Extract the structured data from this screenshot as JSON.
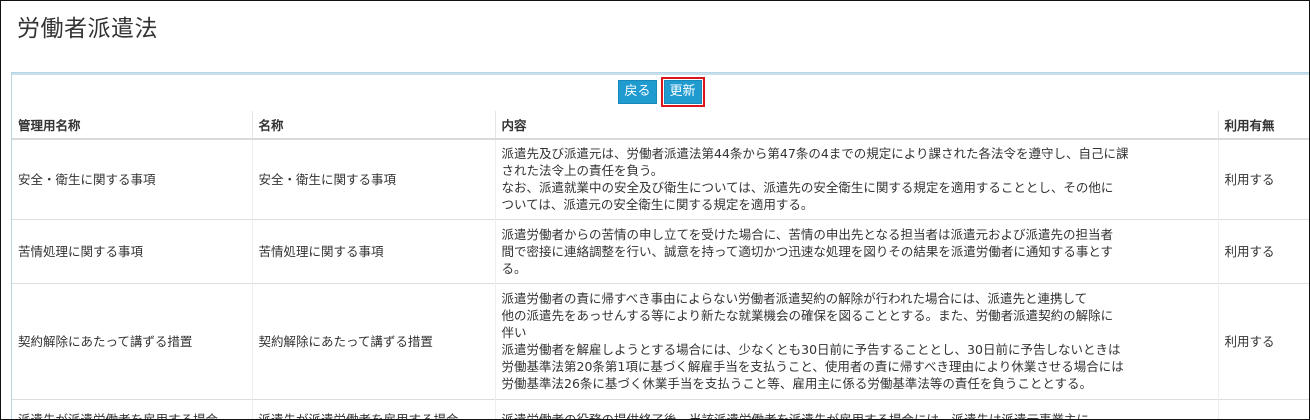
{
  "page": {
    "title": "労働者派遣法"
  },
  "toolbar": {
    "back_label": "戻る",
    "update_label": "更新"
  },
  "table": {
    "headers": {
      "admin_name": "管理用名称",
      "name": "名称",
      "content": "内容",
      "usage": "利用有無"
    },
    "rows": [
      {
        "admin_name": "安全・衛生に関する事項",
        "name": "安全・衛生に関する事項",
        "content_lines": [
          "派遣先及び派遣元は、労働者派遣法第44条から第47条の4までの規定により課された各法令を遵守し、自己に課",
          "された法令上の責任を負う。",
          "なお、派遣就業中の安全及び衛生については、派遣先の安全衛生に関する規定を適用することとし、その他に",
          "ついては、派遣元の安全衛生に関する規定を適用する。"
        ],
        "usage": "利用する"
      },
      {
        "admin_name": "苦情処理に関する事項",
        "name": "苦情処理に関する事項",
        "content_lines": [
          "派遣労働者からの苦情の申し立てを受けた場合に、苦情の申出先となる担当者は派遣元および派遣先の担当者",
          "間で密接に連絡調整を行い、誠意を持って適切かつ迅速な処理を図りその結果を派遣労働者に通知する事とす",
          "る。"
        ],
        "usage": "利用する"
      },
      {
        "admin_name": "契約解除にあたって講ずる措置",
        "name": "契約解除にあたって講ずる措置",
        "content_lines": [
          "派遣労働者の責に帰すべき事由によらない労働者派遣契約の解除が行われた場合には、派遣先と連携して",
          "他の派遣先をあっせんする等により新たな就業機会の確保を図ることとする。また、労働者派遣契約の解除に",
          "伴い",
          "派遣労働者を解雇しようとする場合には、少なくとも30日前に予告することとし、30日前に予告しないときは",
          "労働基準法第20条第1項に基づく解雇手当を支払うこと、使用者の責に帰すべき理由により休業させる場合には",
          "労働基準法26条に基づく休業手当を支払うこと等、雇用主に係る労働基準法等の責任を負うこととする。"
        ],
        "usage": "利用する"
      },
      {
        "admin_name": "派遣先が派遣労働者を雇用する場合",
        "name": "派遣先が派遣労働者を雇用する場合",
        "content_lines": [
          "派遣労働者の役務の提供終了後、当該派遣労働者を派遣先が雇用する場合には、派遣先は派遣元事業主に"
        ],
        "usage": ""
      }
    ]
  }
}
